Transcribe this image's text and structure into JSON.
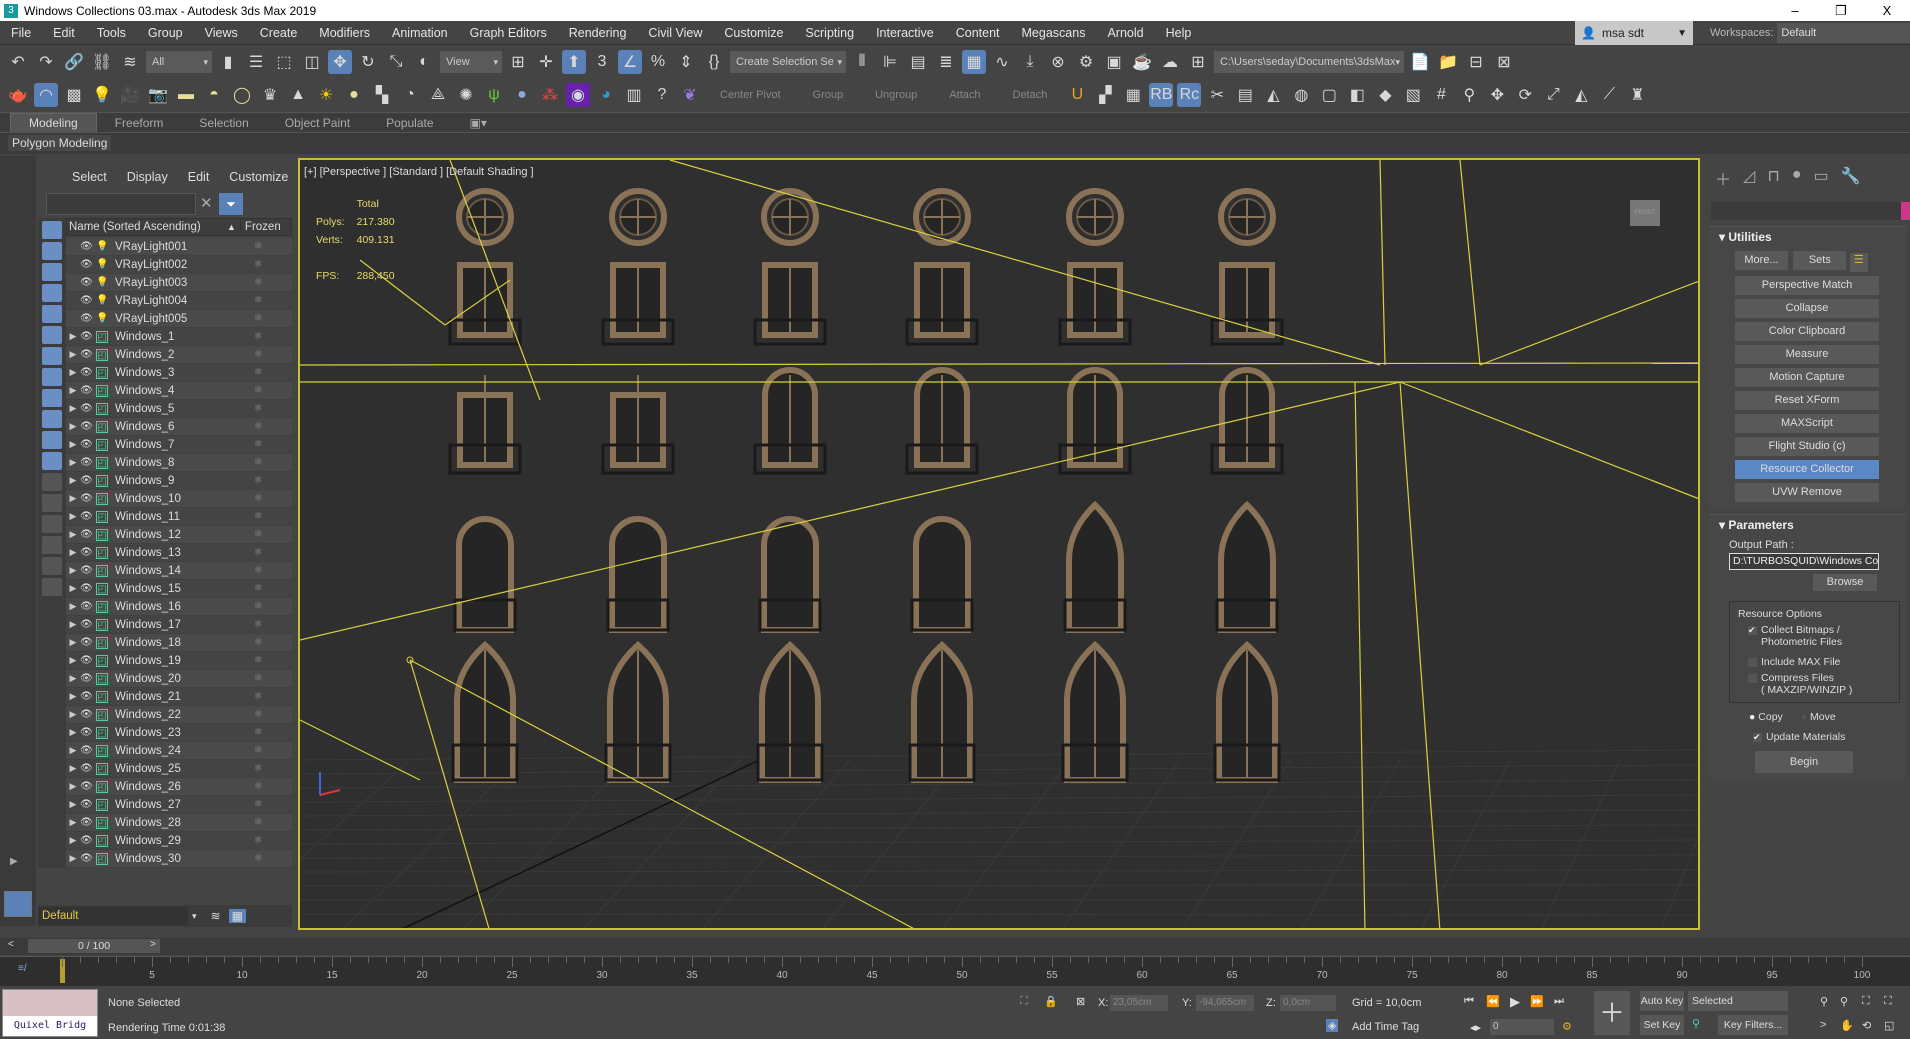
{
  "title": {
    "text": "Windows Collections 03.max - Autodesk 3ds Max 2019",
    "minimize": "–",
    "maximize": "❐",
    "close": "X"
  },
  "menu": [
    "File",
    "Edit",
    "Tools",
    "Group",
    "Views",
    "Create",
    "Modifiers",
    "Animation",
    "Graph Editors",
    "Rendering",
    "Civil View",
    "Customize",
    "Scripting",
    "Interactive",
    "Content",
    "Megascans",
    "Arnold",
    "Help"
  ],
  "user": {
    "name": "msa sdt",
    "workspaces_label": "Workspaces:",
    "workspace": "Default"
  },
  "toolbar1": {
    "filter": "All",
    "refcoord": "View",
    "selection_set": "Create Selection Se",
    "project_path": "C:\\Users\\seday\\Documents\\3dsMax"
  },
  "toolbar2": {
    "center_pivot": "Center Pivot",
    "group": "Group",
    "ungroup": "Ungroup",
    "attach": "Attach",
    "detach": "Detach"
  },
  "ribbon": {
    "tabs": [
      "Modeling",
      "Freeform",
      "Selection",
      "Object Paint",
      "Populate"
    ],
    "active": 0,
    "panel": "Polygon Modeling"
  },
  "explorer": {
    "menu": [
      "Select",
      "Display",
      "Edit",
      "Customize"
    ],
    "search_value": "",
    "col_name": "Name (Sorted Ascending)",
    "col_frozen": "Frozen",
    "items": [
      "VRayLight001",
      "VRayLight002",
      "VRayLight003",
      "VRayLight004",
      "VRayLight005",
      "Windows_1",
      "Windows_2",
      "Windows_3",
      "Windows_4",
      "Windows_5",
      "Windows_6",
      "Windows_7",
      "Windows_8",
      "Windows_9",
      "Windows_10",
      "Windows_11",
      "Windows_12",
      "Windows_13",
      "Windows_14",
      "Windows_15",
      "Windows_16",
      "Windows_17",
      "Windows_18",
      "Windows_19",
      "Windows_20",
      "Windows_21",
      "Windows_22",
      "Windows_23",
      "Windows_24",
      "Windows_25",
      "Windows_26",
      "Windows_27",
      "Windows_28",
      "Windows_29",
      "Windows_30"
    ],
    "layer": "Default"
  },
  "viewport": {
    "label": "[+] [Perspective ] [Standard ] [Default Shading ]",
    "stats": {
      "total": "Total",
      "polys_label": "Polys:",
      "polys": "217.380",
      "verts_label": "Verts:",
      "verts": "409.131",
      "fps_label": "FPS:",
      "fps": "288,450"
    },
    "viewcube": "FRONT"
  },
  "command_panel": {
    "utilities_title": "Utilities",
    "more": "More...",
    "sets": "Sets",
    "buttons": [
      "Perspective Match",
      "Collapse",
      "Color Clipboard",
      "Measure",
      "Motion Capture",
      "Reset XForm",
      "MAXScript",
      "Flight Studio (c)",
      "Resource Collector",
      "UVW Remove"
    ],
    "active_button": 8,
    "parameters_title": "Parameters",
    "output_path_label": "Output Path :",
    "output_path": "D:\\TURBOSQUID\\Windows Co",
    "browse": "Browse",
    "resource_options": "Resource Options",
    "collect_bitmaps": "Collect Bitmaps /",
    "photometric": "Photometric Files",
    "include_max": "Include MAX File",
    "compress": "Compress Files",
    "compress_sub": "( MAXZIP/WINZIP )",
    "copy": "Copy",
    "move": "Move",
    "update_materials": "Update Materials",
    "begin": "Begin"
  },
  "timeline": {
    "slider": "0 / 100",
    "labels": [
      "5",
      "10",
      "15",
      "20",
      "25",
      "30",
      "35",
      "40",
      "45",
      "50",
      "55",
      "60",
      "65",
      "70",
      "75",
      "80",
      "85",
      "90",
      "95",
      "100"
    ]
  },
  "status": {
    "quixel": "Quixel Bridg",
    "selection": "None Selected",
    "render_time": "Rendering Time  0:01:38",
    "x_label": "X:",
    "x": "23,05cm",
    "y_label": "Y:",
    "y": "-94,065cm",
    "z_label": "Z:",
    "z": "0,0cm",
    "grid": "Grid = 10,0cm",
    "add_time_tag": "Add Time Tag",
    "frame": "0",
    "auto_key": "Auto Key",
    "set_key": "Set Key",
    "key_mode": "Selected",
    "key_filters": "Key Filters..."
  }
}
